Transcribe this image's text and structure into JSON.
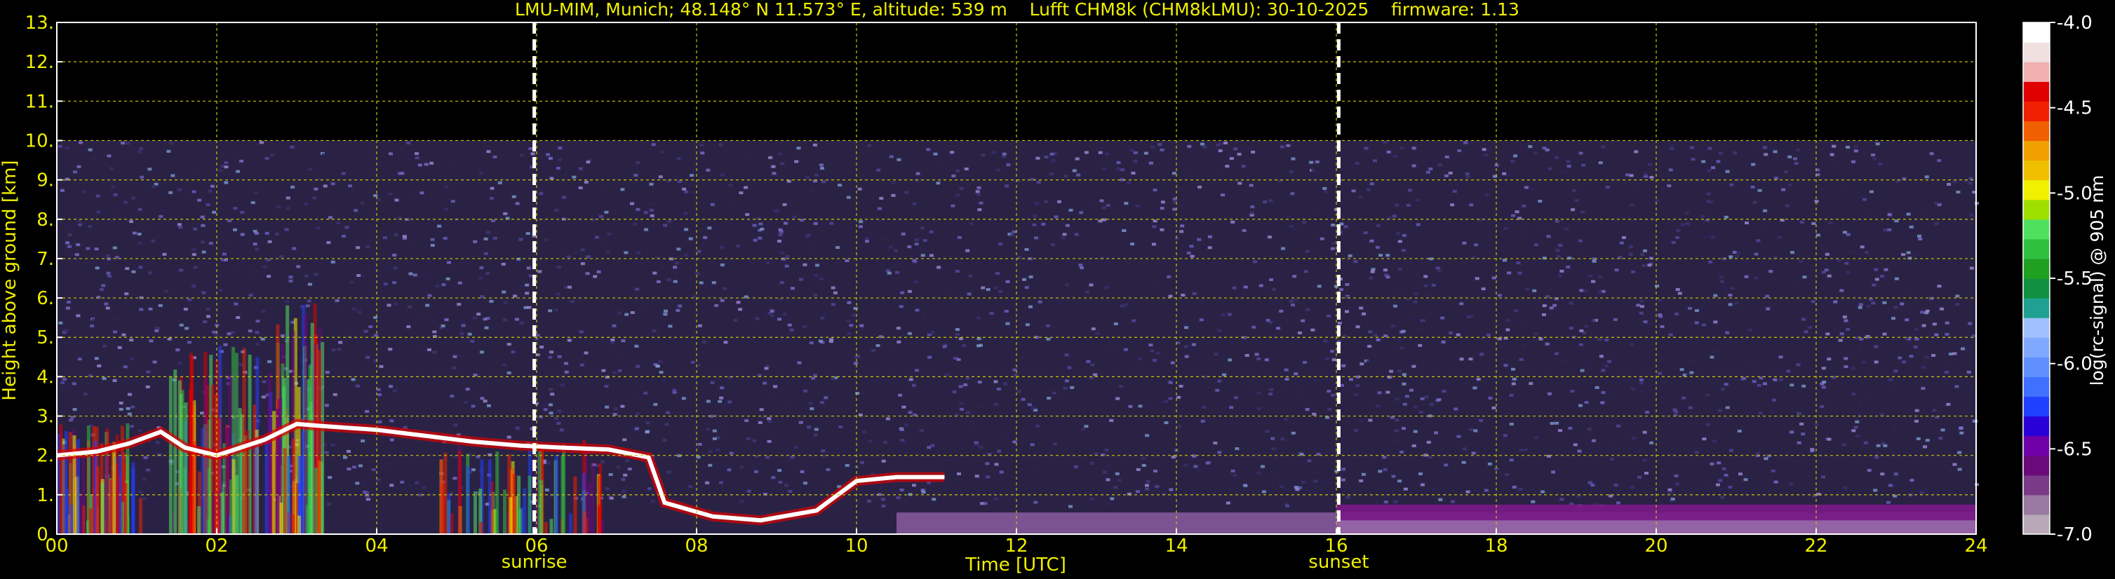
{
  "chart_data": {
    "type": "heatmap",
    "title": "LMU-MIM, Munich; 48.148° N 11.573° E, altitude: 539 m    Lufft CHM8k (CHM8kLMU): 30-10-2025    firmware: 1.13",
    "xlabel": "Time [UTC]",
    "ylabel": "Height above ground [km]",
    "xlim": [
      0,
      24
    ],
    "ylim": [
      0,
      13
    ],
    "x_ticks": [
      "00",
      "02",
      "04",
      "06",
      "08",
      "10",
      "12",
      "14",
      "16",
      "18",
      "20",
      "22",
      "24"
    ],
    "y_ticks": [
      "0.",
      "1.",
      "2.",
      "3.",
      "4.",
      "5.",
      "6.",
      "7.",
      "8.",
      "9.",
      "10.",
      "11.",
      "12.",
      "13."
    ],
    "grid": true,
    "data_ceiling_km": 10,
    "events": [
      {
        "label": "sunrise",
        "time_h": 5.97
      },
      {
        "label": "sunset",
        "time_h": 16.03
      }
    ],
    "cloud_base_track": [
      {
        "t": 0.0,
        "h": 2.0
      },
      {
        "t": 0.5,
        "h": 2.1
      },
      {
        "t": 0.9,
        "h": 2.3
      },
      {
        "t": 1.3,
        "h": 2.6
      },
      {
        "t": 1.6,
        "h": 2.2
      },
      {
        "t": 2.0,
        "h": 2.0
      },
      {
        "t": 2.6,
        "h": 2.4
      },
      {
        "t": 3.0,
        "h": 2.8
      },
      {
        "t": 3.3,
        "h": 2.75
      },
      {
        "t": 4.0,
        "h": 2.65
      },
      {
        "t": 4.6,
        "h": 2.5
      },
      {
        "t": 5.2,
        "h": 2.35
      },
      {
        "t": 5.8,
        "h": 2.25
      },
      {
        "t": 6.3,
        "h": 2.2
      },
      {
        "t": 6.9,
        "h": 2.15
      },
      {
        "t": 7.4,
        "h": 1.95
      },
      {
        "t": 7.6,
        "h": 0.8
      },
      {
        "t": 8.2,
        "h": 0.45
      },
      {
        "t": 8.8,
        "h": 0.35
      },
      {
        "t": 9.5,
        "h": 0.6
      },
      {
        "t": 10.0,
        "h": 1.35
      },
      {
        "t": 10.5,
        "h": 1.45
      },
      {
        "t": 11.1,
        "h": 1.45
      }
    ],
    "colorbar": {
      "label": "log(rc-signal) @ 905 nm",
      "range": [
        -7.0,
        -4.0
      ],
      "ticks": [
        "-4.0",
        "-4.5",
        "-5.0",
        "-5.5",
        "-6.0",
        "-6.5",
        "-7.0"
      ],
      "colors": [
        "#b8a8b8",
        "#9a7aa0",
        "#7a3a88",
        "#6a0a7a",
        "#7000a8",
        "#2a00d8",
        "#2040ff",
        "#4070ff",
        "#6090ff",
        "#80a8ff",
        "#a0c0ff",
        "#20a090",
        "#109040",
        "#20a020",
        "#30c040",
        "#50e060",
        "#a0e000",
        "#f0f000",
        "#f0c000",
        "#f0a000",
        "#f06000",
        "#f02000",
        "#e00000",
        "#f0b0b0",
        "#f0e0e0",
        "#ffffff"
      ]
    }
  }
}
